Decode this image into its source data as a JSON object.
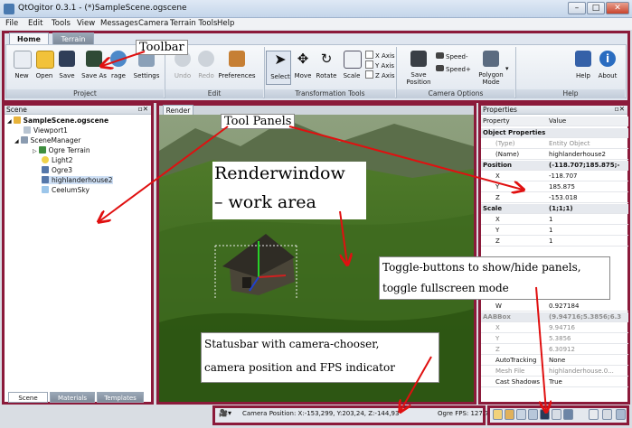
{
  "window": {
    "title": "QtOgitor 0.3.1 - (*)SampleScene.ogscene",
    "minimize": "–",
    "maximize": "□",
    "close": "✕"
  },
  "menu": [
    "File",
    "Edit",
    "Tools",
    "View",
    "Messages",
    "Camera",
    "Terrain Tools",
    "Help"
  ],
  "ribbon": {
    "tabs": {
      "home": "Home",
      "terrain": "Terrain"
    },
    "buttons": {
      "new": "New",
      "open": "Open",
      "save": "Save",
      "save_as": "Save As",
      "storage": "rage",
      "settings": "Settings",
      "undo": "Undo",
      "redo": "Redo",
      "preferences": "Preferences",
      "select": "Select",
      "move": "Move",
      "rotate": "Rotate",
      "scale": "Scale",
      "x_axis": "X Axis",
      "y_axis": "Y Axis",
      "z_axis": "Z Axis",
      "save_position": "Save Position",
      "speed_minus": "Speed-",
      "speed_plus": "Speed+",
      "polygon_mode": "Polygon Mode",
      "help": "Help",
      "about": "About"
    },
    "groups": {
      "project": "Project",
      "edit": "Edit",
      "transformation": "Transformation Tools",
      "camera": "Camera Options",
      "help": "Help"
    }
  },
  "scene_panel": {
    "title": "Scene",
    "tree": [
      "SampleScene.ogscene",
      "Viewport1",
      "SceneManager",
      "Ogre Terrain",
      "Light2",
      "Ogre3",
      "highlanderhouse2",
      "CeelumSky"
    ],
    "tabs": {
      "scene": "Scene",
      "materials": "Materials",
      "templates": "Templates"
    }
  },
  "render": {
    "tab": "Render"
  },
  "properties": {
    "title": "Properties",
    "header": {
      "property": "Property",
      "value": "Value"
    },
    "rows": [
      {
        "name": "Object Properties",
        "value": "",
        "category": true
      },
      {
        "name": "(Type)",
        "value": "Entity Object",
        "muted": true
      },
      {
        "name": "(Name)",
        "value": "highlanderhouse2"
      },
      {
        "name": "Position",
        "value": "(-118.707;185.875;-",
        "category": true
      },
      {
        "name": "X",
        "value": "-118.707"
      },
      {
        "name": "Y",
        "value": "185.875"
      },
      {
        "name": "Z",
        "value": "-153.018"
      },
      {
        "name": "Scale",
        "value": "(1;1;1)",
        "category": true
      },
      {
        "name": "X",
        "value": "1"
      },
      {
        "name": "Y",
        "value": "1"
      },
      {
        "name": "Z",
        "value": "1"
      }
    ],
    "rows_lower": [
      {
        "name": "W",
        "value": "0.927184"
      },
      {
        "name": "AABBox",
        "value": "(9.94716;5.3856;6.3",
        "category": true,
        "muted": true
      },
      {
        "name": "X",
        "value": "9.94716",
        "muted": true
      },
      {
        "name": "Y",
        "value": "5.3856",
        "muted": true
      },
      {
        "name": "Z",
        "value": "6.30912",
        "muted": true
      },
      {
        "name": "AutoTracking",
        "value": "None"
      },
      {
        "name": "Mesh File",
        "value": "highlanderhouse.0...",
        "muted": true
      },
      {
        "name": "Cast Shadows",
        "value": "True"
      }
    ]
  },
  "statusbar": {
    "camera_position": "Camera Position: X:-153,299, Y:203,24, Z:-144,93",
    "fps": "Ogre FPS: 127.7"
  },
  "annotations": {
    "toolbar": "Toolbar",
    "tool_panels": "Tool Panels",
    "renderwindow_1": "Renderwindow",
    "renderwindow_2": "– work area",
    "toggle_1": "Toggle-buttons to show/hide panels,",
    "toggle_2": "toggle fullscreen mode",
    "status_1": "Statusbar with camera-chooser,",
    "status_2": "camera position and FPS indicator"
  },
  "colors": {
    "highlight_frame": "#8b1a3a",
    "arrow": "#e01010"
  }
}
